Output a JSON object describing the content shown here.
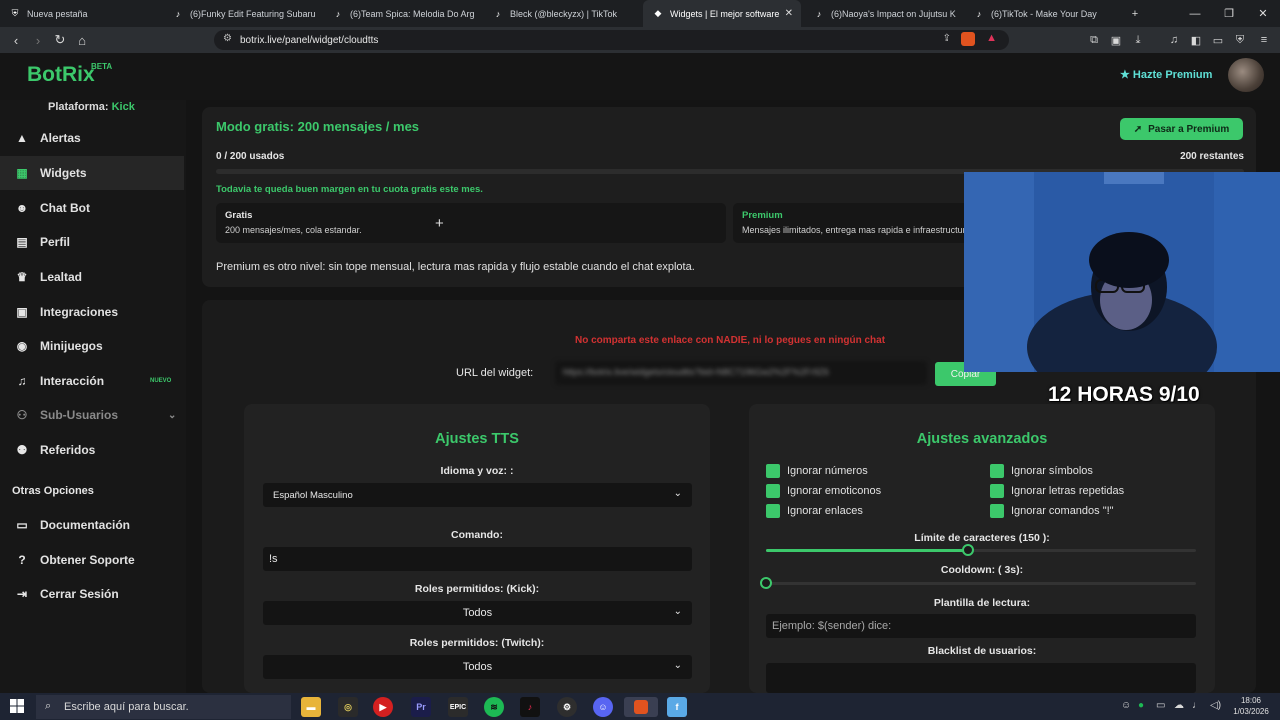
{
  "browser": {
    "tabs": [
      {
        "label": "Nueva pestaña",
        "icon": "brave-shield-icon"
      },
      {
        "label": "(6)Funky Edit Featuring Subaru",
        "icon": "tiktok-icon"
      },
      {
        "label": "(6)Team Spica: Melodia Do Arg",
        "icon": "tiktok-icon"
      },
      {
        "label": "Bleck (@bleckyzx) | TikTok",
        "icon": "tiktok-icon"
      },
      {
        "label": "Widgets | El mejor software",
        "icon": "botrix-icon",
        "active": true
      },
      {
        "label": "(6)Naoya's Impact on Jujutsu K",
        "icon": "tiktok-icon"
      },
      {
        "label": "(6)TikTok - Make Your Day",
        "icon": "tiktok-icon"
      }
    ],
    "url": "botrix.live/panel/widget/cloudtts"
  },
  "header": {
    "logo": "BotRix",
    "beta": "BETA",
    "premium_link": "Hazte Premium"
  },
  "sidebar": {
    "platform_label": "Plataforma:",
    "platform_value": "Kick",
    "items": [
      {
        "label": "Alertas",
        "icon": "warning-icon"
      },
      {
        "label": "Widgets",
        "icon": "grid-icon",
        "active": true
      },
      {
        "label": "Chat Bot",
        "icon": "robot-icon"
      },
      {
        "label": "Perfil",
        "icon": "id-card-icon"
      },
      {
        "label": "Lealtad",
        "icon": "trophy-icon"
      },
      {
        "label": "Integraciones",
        "icon": "plug-icon"
      },
      {
        "label": "Minijuegos",
        "icon": "gamepad-icon"
      },
      {
        "label": "Interacción",
        "icon": "music-note-icon",
        "badge": "NUEVO"
      },
      {
        "label": "Sub-Usuarios",
        "icon": "users-icon",
        "disabled": true
      },
      {
        "label": "Referidos",
        "icon": "user-group-icon"
      }
    ],
    "section_title": "Otras Opciones",
    "other_items": [
      {
        "label": "Documentación",
        "icon": "book-icon"
      },
      {
        "label": "Obtener Soporte",
        "icon": "help-icon"
      },
      {
        "label": "Cerrar Sesión",
        "icon": "logout-icon"
      }
    ]
  },
  "quota": {
    "title": "Modo gratis: 200 mensajes / mes",
    "used": "0 / 200 usados",
    "remaining": "200 restantes",
    "progress": 0,
    "note": "Todavia te queda buen margen en tu cuota gratis este mes.",
    "premium_button": "Pasar a Premium",
    "plans": [
      {
        "name": "Gratis",
        "desc": "200 mensajes/mes, cola estandar."
      },
      {
        "name": "Premium",
        "desc": "Mensajes ilimitados, entrega mas rapida e infraestructura prioritaria."
      }
    ],
    "footer": "Premium es otro nivel: sin tope mensual, lectura mas rapida y flujo estable cuando el chat explota."
  },
  "widget": {
    "warning": "No comparta este enlace con NADIE, ni lo pegues en ningún chat",
    "url_label": "URL del widget:",
    "url_value": "https://botrix.live/widgets/cloudtts?bid=N8C7196Gw2%2F%2Fr9Z6",
    "copy_button": "Copiar"
  },
  "tts": {
    "title": "Ajustes TTS",
    "voice_label": "Idioma y voz: :",
    "voice_value": "Español Masculino",
    "command_label": "Comando:",
    "command_value": "!s",
    "roles_kick_label": "Roles permitidos: (Kick):",
    "roles_kick_value": "Todos",
    "roles_twitch_label": "Roles permitidos: (Twitch):",
    "roles_twitch_value": "Todos"
  },
  "advanced": {
    "title": "Ajustes avanzados",
    "checkboxes": [
      {
        "label": "Ignorar números",
        "checked": true
      },
      {
        "label": "Ignorar símbolos",
        "checked": true
      },
      {
        "label": "Ignorar emoticonos",
        "checked": true
      },
      {
        "label": "Ignorar letras repetidas",
        "checked": true
      },
      {
        "label": "Ignorar enlaces",
        "checked": true
      },
      {
        "label": "Ignorar comandos \"!\"",
        "checked": true
      }
    ],
    "char_limit_label": "Límite de caracteres (150 ):",
    "char_limit_fraction": 0.47,
    "cooldown_label": "Cooldown: ( 3s):",
    "cooldown_fraction": 0.0,
    "template_label": "Plantilla de lectura:",
    "template_placeholder": "Ejemplo: $(sender) dice:",
    "blacklist_label": "Blacklist de usuarios:"
  },
  "overlay": {
    "stream_text": "12 HORAS 9/10"
  },
  "taskbar": {
    "search_placeholder": "Escribe aquí para buscar.",
    "time": "18:06",
    "date": "1/03/2026"
  },
  "colors": {
    "accent": "#3cc86b",
    "warning": "#d23232",
    "premium_link": "#5fe0d6"
  }
}
